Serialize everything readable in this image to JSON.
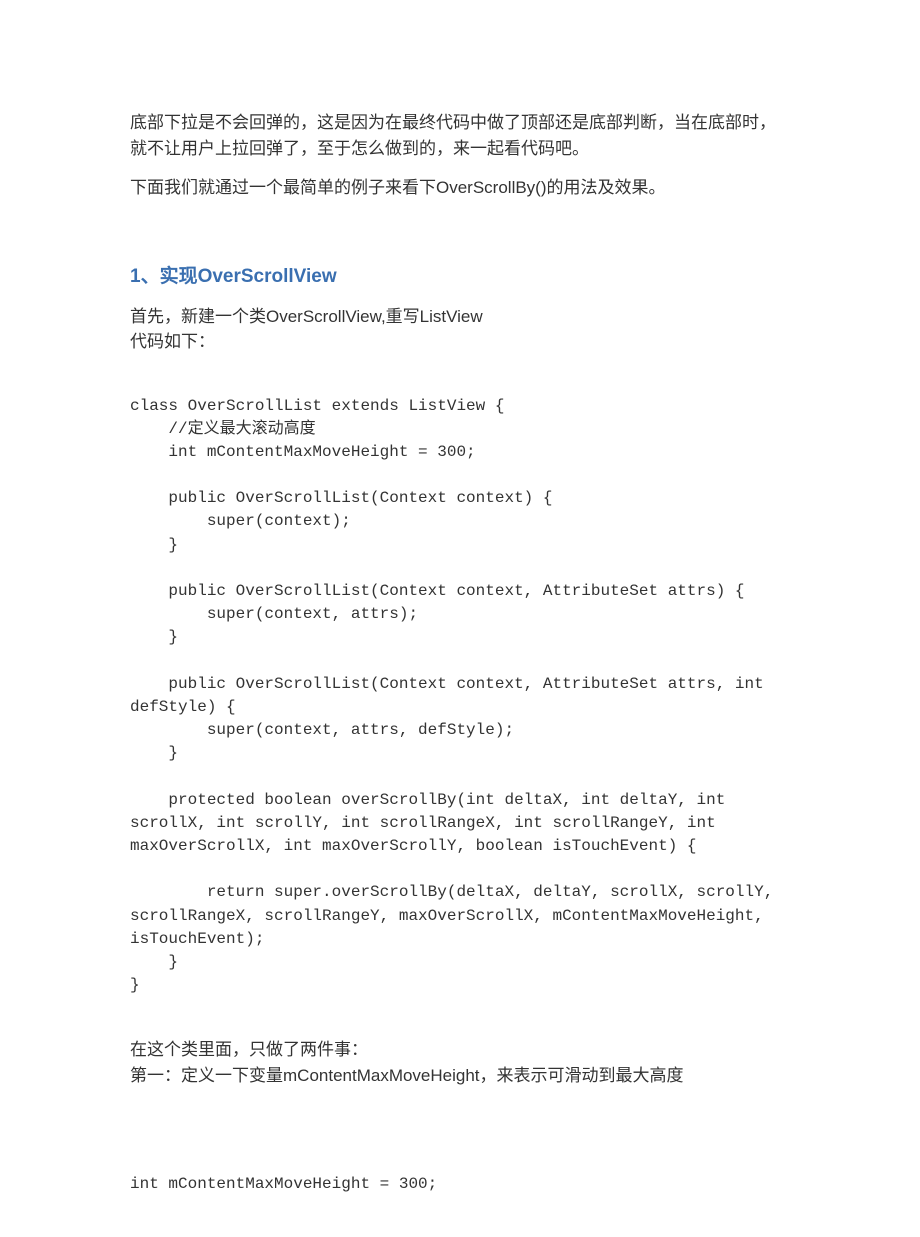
{
  "paragraphs": {
    "p1": "底部下拉是不会回弹的，这是因为在最终代码中做了顶部还是底部判断，当在底部时，就不让用户上拉回弹了，至于怎么做到的，来一起看代码吧。",
    "p2": "下面我们就通过一个最简单的例子来看下OverScrollBy()的用法及效果。",
    "p3": "首先，新建一个类OverScrollView,重写ListView",
    "p4": "代码如下：",
    "p5": "在这个类里面，只做了两件事：",
    "p6": "第一：定义一下变量mContentMaxMoveHeight，来表示可滑动到最大高度"
  },
  "heading1": "1、实现OverScrollView",
  "code1": "class OverScrollList extends ListView {\n    //定义最大滚动高度\n    int mContentMaxMoveHeight = 300;\n\n    public OverScrollList(Context context) {\n        super(context);\n    }\n\n    public OverScrollList(Context context, AttributeSet attrs) {\n        super(context, attrs);\n    }\n\n    public OverScrollList(Context context, AttributeSet attrs, int defStyle) {\n        super(context, attrs, defStyle);\n    }\n\n    protected boolean overScrollBy(int deltaX, int deltaY, int scrollX, int scrollY, int scrollRangeX, int scrollRangeY, int maxOverScrollX, int maxOverScrollY, boolean isTouchEvent) {\n\n        return super.overScrollBy(deltaX, deltaY, scrollX, scrollY, scrollRangeX, scrollRangeY, maxOverScrollX, mContentMaxMoveHeight, isTouchEvent);\n    }\n}",
  "code2": "int mContentMaxMoveHeight = 300;"
}
